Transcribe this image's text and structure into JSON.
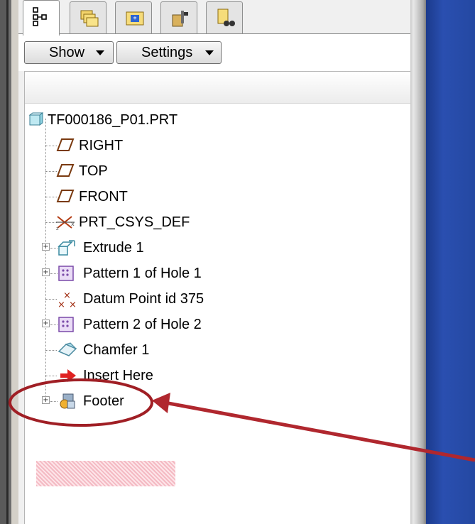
{
  "toolbar": {
    "show_label": "Show",
    "settings_label": "Settings"
  },
  "tree": {
    "root": "TF000186_P01.PRT",
    "items": [
      {
        "label": "RIGHT",
        "icon": "datum-plane-icon"
      },
      {
        "label": "TOP",
        "icon": "datum-plane-icon"
      },
      {
        "label": "FRONT",
        "icon": "datum-plane-icon"
      },
      {
        "label": "PRT_CSYS_DEF",
        "icon": "csys-icon"
      },
      {
        "label": "Extrude 1",
        "icon": "extrude-icon"
      },
      {
        "label": "Pattern 1 of Hole 1",
        "icon": "pattern-icon"
      },
      {
        "label": "Datum Point id 375",
        "icon": "datum-point-icon"
      },
      {
        "label": "Pattern 2 of Hole 2",
        "icon": "pattern-icon"
      },
      {
        "label": "Chamfer 1",
        "icon": "chamfer-icon"
      },
      {
        "label": "Insert Here",
        "icon": "insert-arrow-icon"
      },
      {
        "label": "Footer",
        "icon": "group-icon"
      }
    ]
  },
  "colors": {
    "annotation": "#a01f25",
    "viewport": "#2448a2",
    "highlight": "#f4b6c0"
  }
}
